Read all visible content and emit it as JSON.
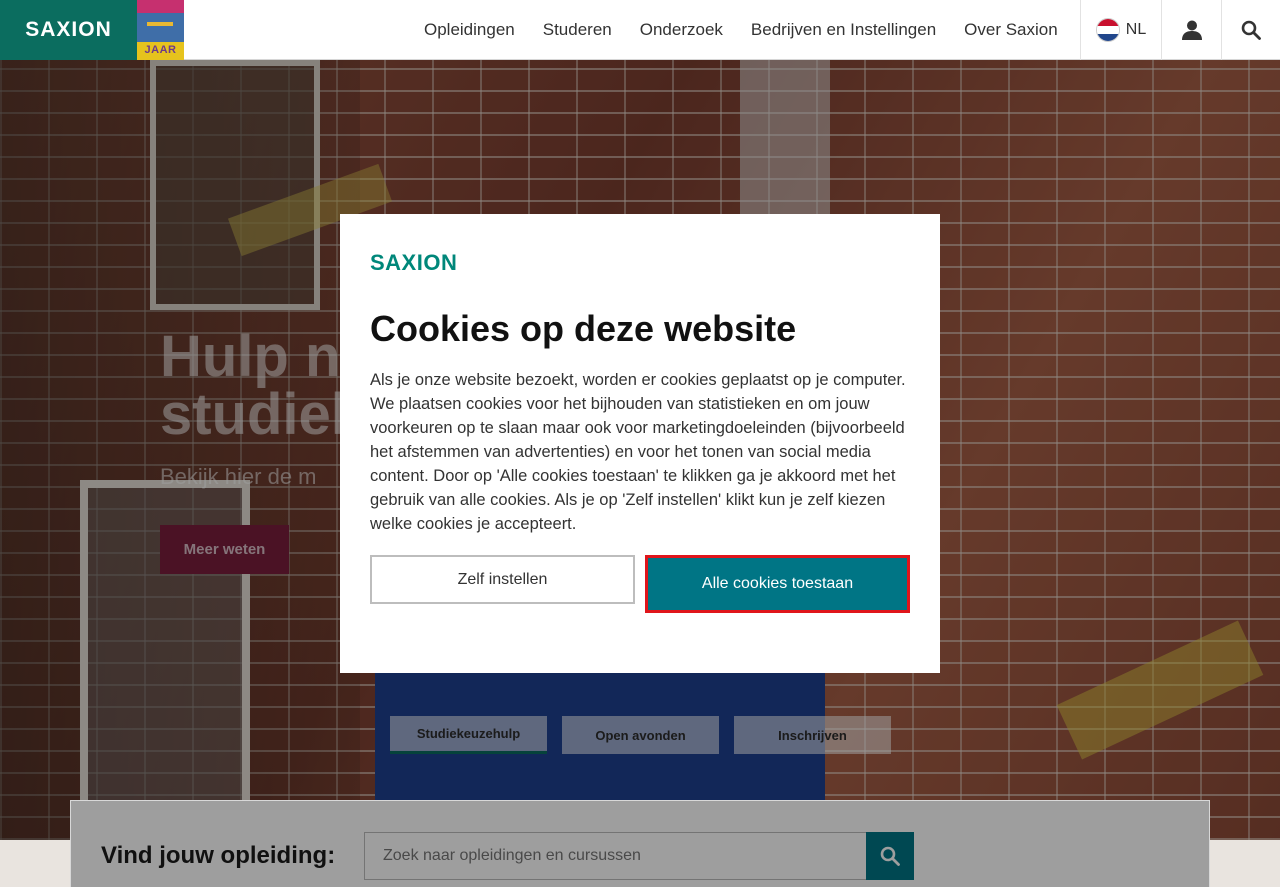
{
  "header": {
    "logo": "SAXION",
    "anniversary_badge": "JAAR",
    "nav": [
      "Opleidingen",
      "Studeren",
      "Onderzoek",
      "Bedrijven en Instellingen",
      "Over Saxion"
    ],
    "language": "NL",
    "icons": {
      "language": "netherlands-flag-icon",
      "account": "user-icon",
      "search": "search-icon"
    }
  },
  "hero": {
    "title": "Hulp n... studiek...",
    "title_visible_left": "Hulp n",
    "title_visible_left_2": "studiek",
    "subtitle": "Bekijk hier de m",
    "button": "Meer weten",
    "tabs": [
      "Studiekeuzehulp",
      "Open avonden",
      "Inschrijven"
    ]
  },
  "search": {
    "label": "Vind jouw opleiding:",
    "placeholder": "Zoek naar opleidingen en cursussen"
  },
  "modal": {
    "logo": "SAXION",
    "title": "Cookies op deze website",
    "body": "Als je onze website bezoekt, worden er cookies geplaatst op je computer. We plaatsen cookies voor het bijhouden van statistieken en om jouw voorkeuren op te slaan maar ook voor marketingdoeleinden (bijvoorbeeld het afstemmen van advertenties) en voor het tonen van social media content. Door op 'Alle cookies toestaan' te klikken ga je akkoord met het gebruik van alle cookies. Als je op 'Zelf instellen' klikt kun je zelf kiezen welke cookies je accepteert.",
    "secondary_button": "Zelf instellen",
    "primary_button": "Alle cookies toestaan"
  },
  "colors": {
    "brand_green": "#0b6d5f",
    "teal_button": "#007585",
    "highlight_red": "#e0151b",
    "hero_button": "#7a1e3c"
  }
}
